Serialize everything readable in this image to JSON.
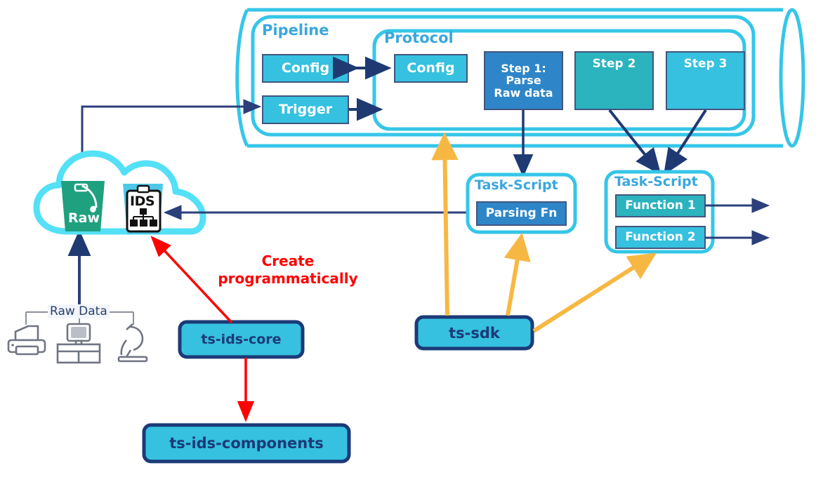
{
  "diagram": {
    "title": "TetraScience pipeline / IDS architecture diagram",
    "colors": {
      "cyan_border": "#35c6e8",
      "cyan_fill": "#35c1df",
      "teal_fill": "#2bb3be",
      "blue_fill": "#2e86c8",
      "green_fill": "#1fa07e",
      "navy": "#1f3a73",
      "navy_line": "#2b3f7a",
      "orange": "#f7b843",
      "red": "#ff0000",
      "title_blue": "#3aa7dd",
      "gray_icon": "#7a7f8c"
    },
    "containers": {
      "cylinder": {
        "name": "outer-cylinder"
      },
      "pipeline": {
        "label": "Pipeline"
      },
      "protocol": {
        "label": "Protocol"
      },
      "task_script_left": {
        "label": "Task-Script"
      },
      "task_script_right": {
        "label": "Task-Script"
      }
    },
    "boxes": {
      "pipeline_config": "Config",
      "pipeline_trigger": "Trigger",
      "protocol_config": "Config",
      "step1": "Step 1:\nParse\nRaw data",
      "step1_line1": "Step 1:",
      "step1_line2": "Parse",
      "step1_line3": "Raw data",
      "step2": "Step 2",
      "step3": "Step 3",
      "parsing_fn": "Parsing Fn",
      "function1": "Function 1",
      "function2": "Function 2"
    },
    "packages": {
      "ts_ids_core": "ts-ids-core",
      "ts_ids_components": "ts-ids-components",
      "ts_sdk": "ts-sdk"
    },
    "cloud": {
      "raw_bucket_label": "Raw",
      "ids_bucket_label": "IDS"
    },
    "annotations": {
      "create_programmatically_line1": "Create",
      "create_programmatically_line2": "programmatically",
      "raw_data": "Raw Data"
    },
    "instruments": [
      {
        "name": "printer-icon"
      },
      {
        "name": "analyzer-icon"
      },
      {
        "name": "microscope-icon"
      }
    ]
  }
}
